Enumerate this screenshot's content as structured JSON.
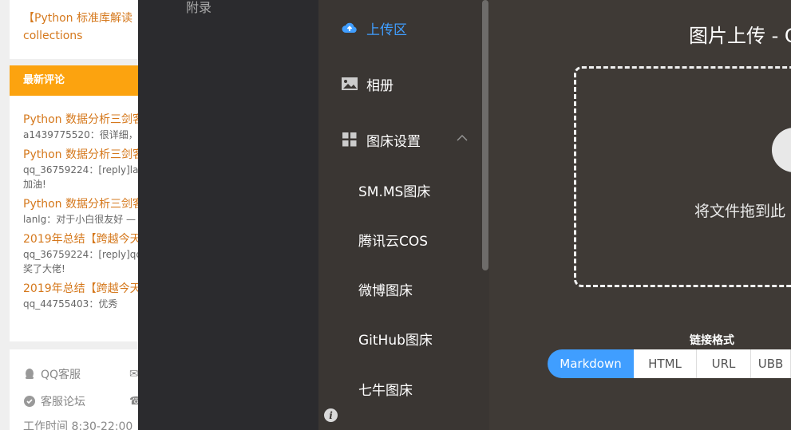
{
  "blog": {
    "top_title_1": "【Python 标准库解读",
    "top_title_2": "collections",
    "comments_header": "最新评论",
    "comments": [
      {
        "title": "Python 数据分析三剑客",
        "body": "a1439775520：很详细，"
      },
      {
        "title": "Python 数据分析三剑客",
        "body": "qq_36759224：[reply]la",
        "body2": "加油!"
      },
      {
        "title": "Python 数据分析三剑客",
        "body": "lanlg：对于小白很友好 —"
      },
      {
        "title": "2019年总结【跨越今天",
        "body": "qq_36759224：[reply]qq",
        "body2": "奖了大佬!"
      },
      {
        "title": "2019年总结【跨越今天",
        "body": "qq_44755403：优秀"
      }
    ],
    "service": {
      "qq": "QQ客服",
      "forum": "客服论坛",
      "hours": "工作时间 8:30-22:00"
    }
  },
  "doc": {
    "appendix": "附录"
  },
  "sidebar": {
    "upload": "上传区",
    "album": "相册",
    "settings": "图床设置",
    "subs": [
      "SM.MS图床",
      "腾讯云COS",
      "微博图床",
      "GitHub图床",
      "七牛图床"
    ]
  },
  "main": {
    "title": "图片上传 - G",
    "drop_text": "将文件拖到此",
    "link_label": "链接格式",
    "tabs": [
      "Markdown",
      "HTML",
      "URL",
      "UBB"
    ]
  },
  "colors": {
    "accent": "#409eff",
    "orange": "#fca30f",
    "link": "#d5781c"
  }
}
